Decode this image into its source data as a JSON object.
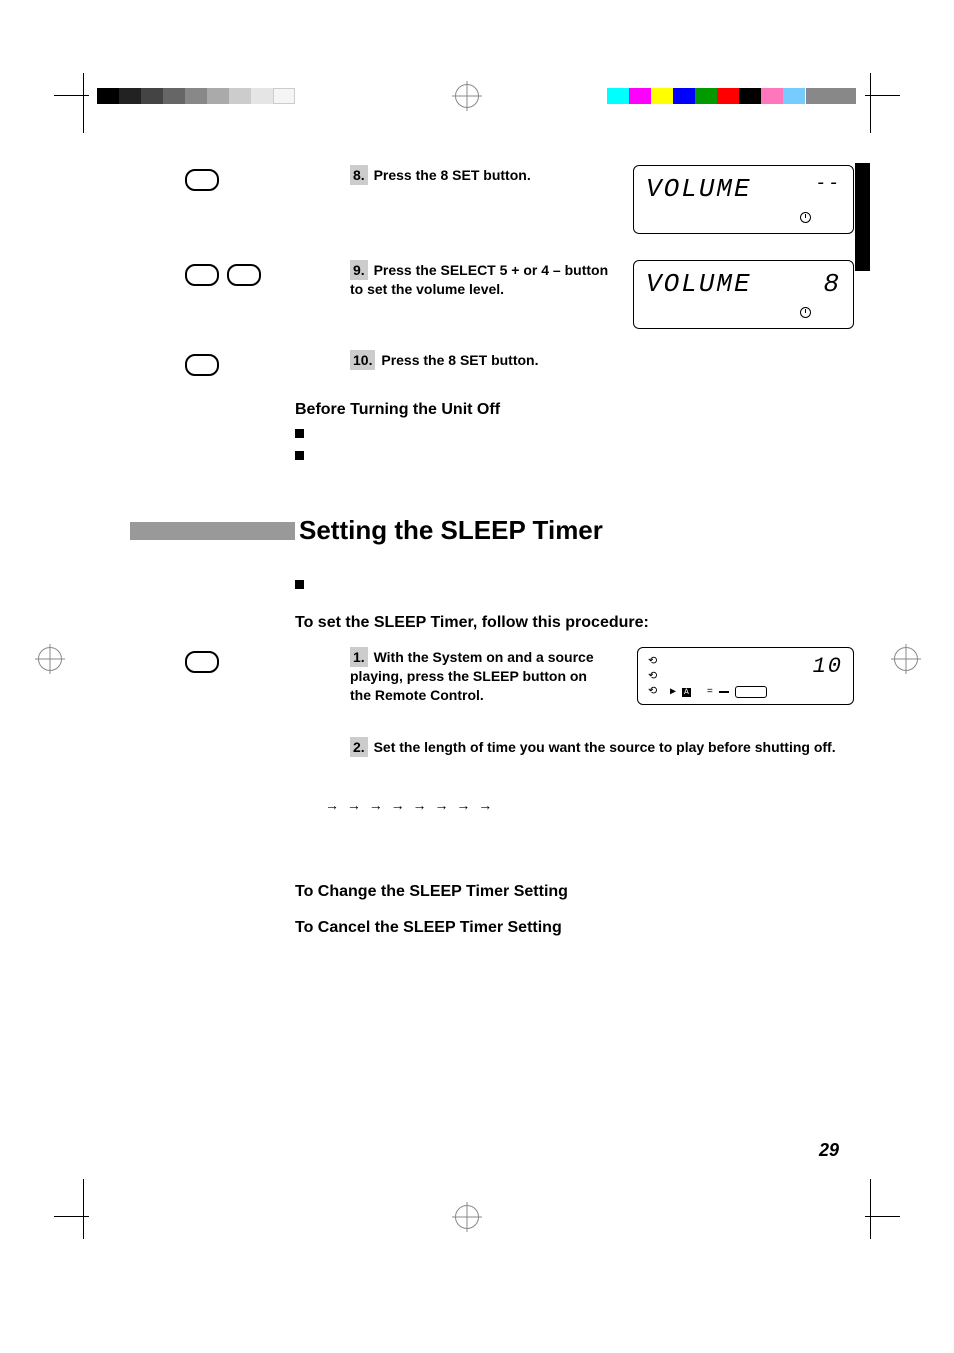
{
  "steps": {
    "s8": {
      "num": "8.",
      "text": "Press the 8 SET button."
    },
    "s9": {
      "num": "9.",
      "text": "Press the SELECT 5 + or 4 – button to set the volume level."
    },
    "s10": {
      "num": "10.",
      "text": "Press the 8 SET button."
    }
  },
  "before_off": "Before Turning the Unit Off",
  "section_title": "Setting the SLEEP Timer",
  "sleep_intro": "To set the SLEEP Timer, follow this procedure:",
  "sleep_steps": {
    "s1": {
      "num": "1.",
      "text": "With the System on and a source playing, press the SLEEP button on the Remote Control."
    },
    "s2": {
      "num": "2.",
      "text": "Set the length of time you want the source to play before shutting off."
    }
  },
  "change_heading": "To Change the SLEEP Timer Setting",
  "cancel_heading": "To Cancel the SLEEP Timer Setting",
  "display1": {
    "label": "VOLUME",
    "val": "--"
  },
  "display2": {
    "label": "VOLUME",
    "val": "8"
  },
  "display3": {
    "val": "10"
  },
  "arrows": "→     →     →     →     →     →     →          →",
  "page_number": "29"
}
